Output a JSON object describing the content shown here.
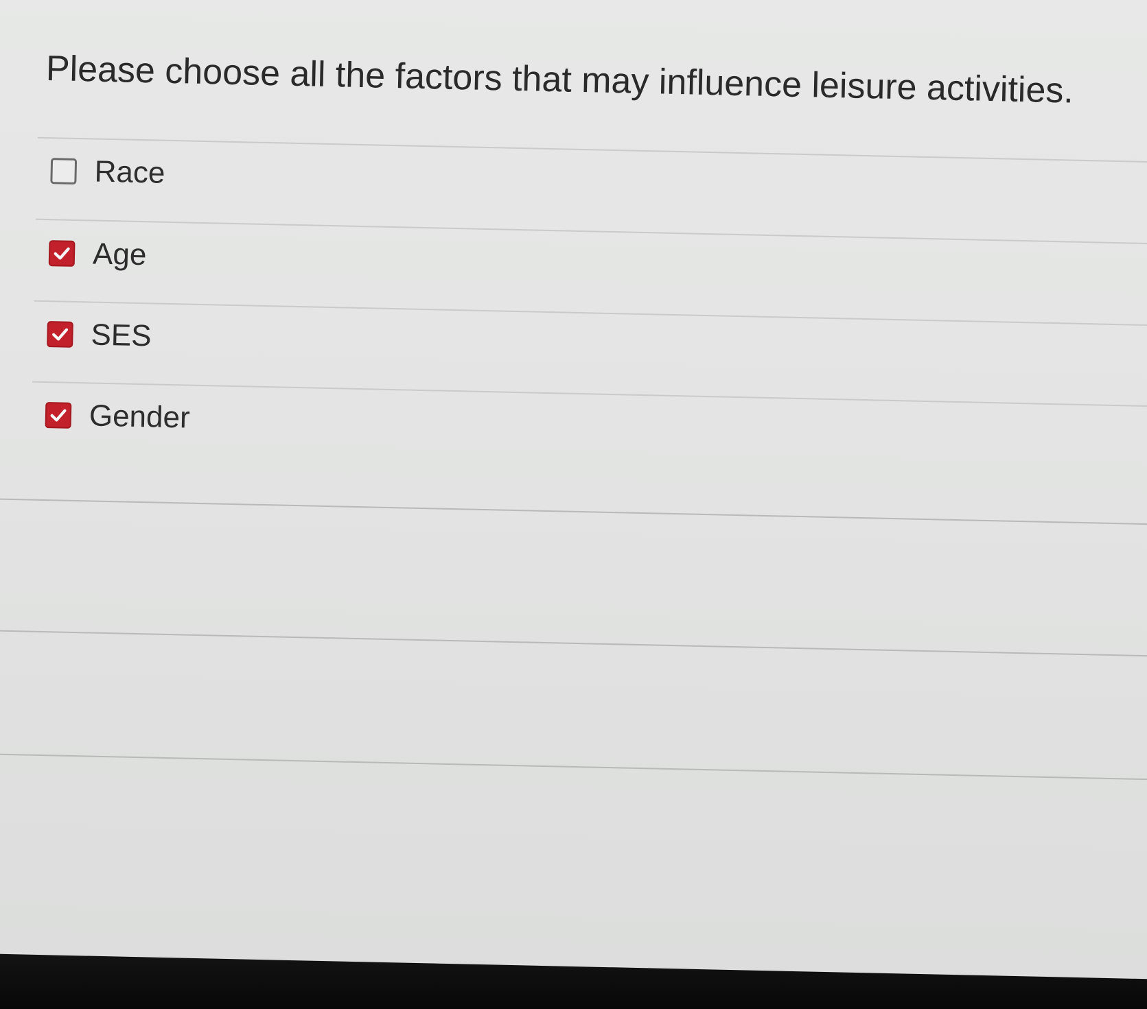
{
  "question": {
    "text": "Please choose all the factors that may influence leisure activities."
  },
  "options": [
    {
      "label": "Race",
      "checked": false
    },
    {
      "label": "Age",
      "checked": true
    },
    {
      "label": "SES",
      "checked": true
    },
    {
      "label": "Gender",
      "checked": true
    }
  ],
  "colors": {
    "checked_box": "#c2202a",
    "background": "#e4e5e4",
    "text": "#2a2a2a"
  }
}
